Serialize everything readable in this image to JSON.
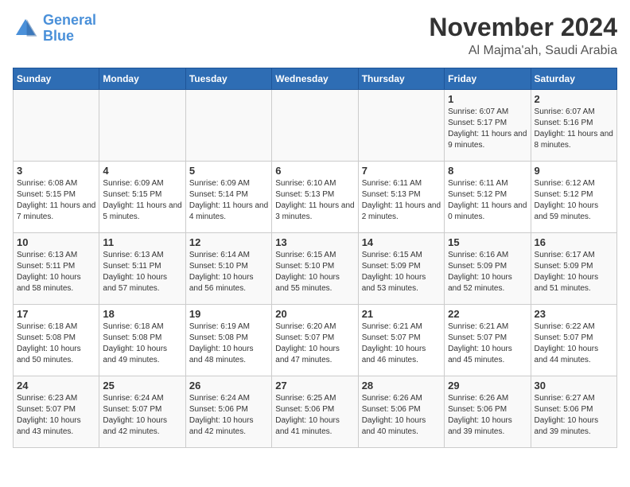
{
  "logo": {
    "line1": "General",
    "line2": "Blue"
  },
  "header": {
    "month": "November 2024",
    "location": "Al Majma'ah, Saudi Arabia"
  },
  "days_of_week": [
    "Sunday",
    "Monday",
    "Tuesday",
    "Wednesday",
    "Thursday",
    "Friday",
    "Saturday"
  ],
  "weeks": [
    [
      {
        "day": "",
        "info": ""
      },
      {
        "day": "",
        "info": ""
      },
      {
        "day": "",
        "info": ""
      },
      {
        "day": "",
        "info": ""
      },
      {
        "day": "",
        "info": ""
      },
      {
        "day": "1",
        "info": "Sunrise: 6:07 AM\nSunset: 5:17 PM\nDaylight: 11 hours and 9 minutes."
      },
      {
        "day": "2",
        "info": "Sunrise: 6:07 AM\nSunset: 5:16 PM\nDaylight: 11 hours and 8 minutes."
      }
    ],
    [
      {
        "day": "3",
        "info": "Sunrise: 6:08 AM\nSunset: 5:15 PM\nDaylight: 11 hours and 7 minutes."
      },
      {
        "day": "4",
        "info": "Sunrise: 6:09 AM\nSunset: 5:15 PM\nDaylight: 11 hours and 5 minutes."
      },
      {
        "day": "5",
        "info": "Sunrise: 6:09 AM\nSunset: 5:14 PM\nDaylight: 11 hours and 4 minutes."
      },
      {
        "day": "6",
        "info": "Sunrise: 6:10 AM\nSunset: 5:13 PM\nDaylight: 11 hours and 3 minutes."
      },
      {
        "day": "7",
        "info": "Sunrise: 6:11 AM\nSunset: 5:13 PM\nDaylight: 11 hours and 2 minutes."
      },
      {
        "day": "8",
        "info": "Sunrise: 6:11 AM\nSunset: 5:12 PM\nDaylight: 11 hours and 0 minutes."
      },
      {
        "day": "9",
        "info": "Sunrise: 6:12 AM\nSunset: 5:12 PM\nDaylight: 10 hours and 59 minutes."
      }
    ],
    [
      {
        "day": "10",
        "info": "Sunrise: 6:13 AM\nSunset: 5:11 PM\nDaylight: 10 hours and 58 minutes."
      },
      {
        "day": "11",
        "info": "Sunrise: 6:13 AM\nSunset: 5:11 PM\nDaylight: 10 hours and 57 minutes."
      },
      {
        "day": "12",
        "info": "Sunrise: 6:14 AM\nSunset: 5:10 PM\nDaylight: 10 hours and 56 minutes."
      },
      {
        "day": "13",
        "info": "Sunrise: 6:15 AM\nSunset: 5:10 PM\nDaylight: 10 hours and 55 minutes."
      },
      {
        "day": "14",
        "info": "Sunrise: 6:15 AM\nSunset: 5:09 PM\nDaylight: 10 hours and 53 minutes."
      },
      {
        "day": "15",
        "info": "Sunrise: 6:16 AM\nSunset: 5:09 PM\nDaylight: 10 hours and 52 minutes."
      },
      {
        "day": "16",
        "info": "Sunrise: 6:17 AM\nSunset: 5:09 PM\nDaylight: 10 hours and 51 minutes."
      }
    ],
    [
      {
        "day": "17",
        "info": "Sunrise: 6:18 AM\nSunset: 5:08 PM\nDaylight: 10 hours and 50 minutes."
      },
      {
        "day": "18",
        "info": "Sunrise: 6:18 AM\nSunset: 5:08 PM\nDaylight: 10 hours and 49 minutes."
      },
      {
        "day": "19",
        "info": "Sunrise: 6:19 AM\nSunset: 5:08 PM\nDaylight: 10 hours and 48 minutes."
      },
      {
        "day": "20",
        "info": "Sunrise: 6:20 AM\nSunset: 5:07 PM\nDaylight: 10 hours and 47 minutes."
      },
      {
        "day": "21",
        "info": "Sunrise: 6:21 AM\nSunset: 5:07 PM\nDaylight: 10 hours and 46 minutes."
      },
      {
        "day": "22",
        "info": "Sunrise: 6:21 AM\nSunset: 5:07 PM\nDaylight: 10 hours and 45 minutes."
      },
      {
        "day": "23",
        "info": "Sunrise: 6:22 AM\nSunset: 5:07 PM\nDaylight: 10 hours and 44 minutes."
      }
    ],
    [
      {
        "day": "24",
        "info": "Sunrise: 6:23 AM\nSunset: 5:07 PM\nDaylight: 10 hours and 43 minutes."
      },
      {
        "day": "25",
        "info": "Sunrise: 6:24 AM\nSunset: 5:07 PM\nDaylight: 10 hours and 42 minutes."
      },
      {
        "day": "26",
        "info": "Sunrise: 6:24 AM\nSunset: 5:06 PM\nDaylight: 10 hours and 42 minutes."
      },
      {
        "day": "27",
        "info": "Sunrise: 6:25 AM\nSunset: 5:06 PM\nDaylight: 10 hours and 41 minutes."
      },
      {
        "day": "28",
        "info": "Sunrise: 6:26 AM\nSunset: 5:06 PM\nDaylight: 10 hours and 40 minutes."
      },
      {
        "day": "29",
        "info": "Sunrise: 6:26 AM\nSunset: 5:06 PM\nDaylight: 10 hours and 39 minutes."
      },
      {
        "day": "30",
        "info": "Sunrise: 6:27 AM\nSunset: 5:06 PM\nDaylight: 10 hours and 39 minutes."
      }
    ]
  ]
}
